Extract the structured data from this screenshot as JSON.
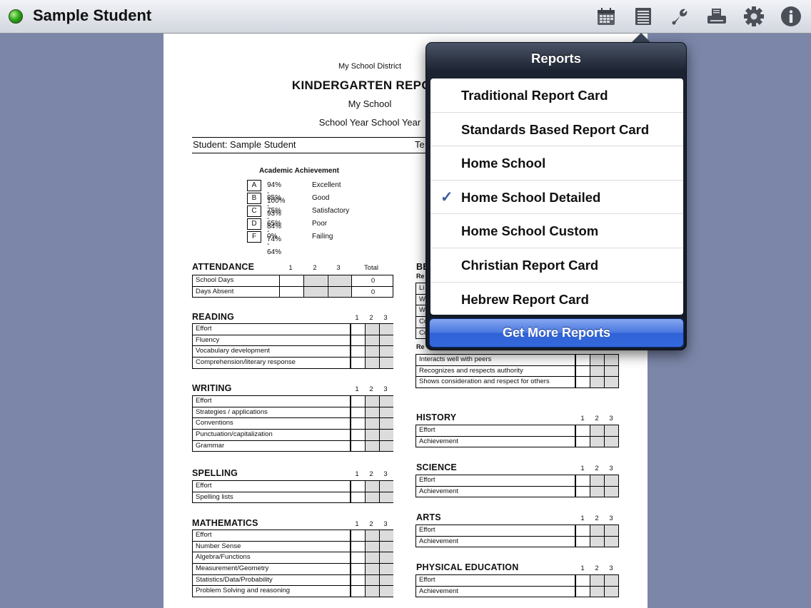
{
  "app": {
    "title": "Sample Student"
  },
  "toolbar": {
    "icons": [
      "calendar-icon",
      "list-icon",
      "wrench-icon",
      "printer-icon",
      "gear-icon",
      "info-icon"
    ]
  },
  "report": {
    "district": "My School District",
    "title": "KINDERGARTEN REPORT",
    "school": "My School",
    "year": "School Year School Year",
    "student": "Student: Sample Student",
    "teacher_fragment": "Te",
    "academic_title": "Academic Achievement",
    "grading_scale": [
      {
        "letter": "A",
        "range": "94% - 100%",
        "desc": "Excellent"
      },
      {
        "letter": "B",
        "range": "85% - 93%",
        "desc": "Good"
      },
      {
        "letter": "C",
        "range": "75% - 84%",
        "desc": "Satisfactory"
      },
      {
        "letter": "D",
        "range": "65% - 74%",
        "desc": "Poor"
      },
      {
        "letter": "F",
        "range": "0% - 64%",
        "desc": "Failing"
      }
    ],
    "attendance": {
      "title": "ATTENDANCE",
      "cols": [
        "1",
        "2",
        "3",
        "Total"
      ],
      "rows": [
        {
          "label": "School Days",
          "total": "0"
        },
        {
          "label": "Days Absent",
          "total": "0"
        }
      ]
    },
    "col_labels": [
      "1",
      "2",
      "3"
    ],
    "reading": {
      "title": "READING",
      "rows": [
        "Effort",
        "Fluency",
        "Vocabulary development",
        "Comprehension/literary response"
      ]
    },
    "writing": {
      "title": "WRITING",
      "rows": [
        "Effort",
        "Strategies / applications",
        "Conventions",
        "Punctuation/capitalization",
        "Grammar"
      ]
    },
    "spelling": {
      "title": "SPELLING",
      "rows": [
        "Effort",
        "Spelling lists"
      ]
    },
    "mathematics": {
      "title": "MATHEMATICS",
      "rows": [
        "Effort",
        "Number Sense",
        "Algebra/Functions",
        "Measurement/Geometry",
        "Statistics/Data/Probability",
        "Problem Solving and reasoning"
      ]
    },
    "behavior_fragment": {
      "title": "BE",
      "sub1": "Re",
      "rows_partial": [
        "Li",
        "W",
        "W",
        "Co",
        "Co"
      ],
      "sub2": "Re"
    },
    "social": {
      "rows": [
        "Interacts well with peers",
        "Recognizes and respects authority",
        "Shows consideration and respect for others"
      ]
    },
    "history": {
      "title": "HISTORY",
      "rows": [
        "Effort",
        "Achievement"
      ]
    },
    "science": {
      "title": "SCIENCE",
      "rows": [
        "Effort",
        "Achievement"
      ]
    },
    "arts": {
      "title": "ARTS",
      "rows": [
        "Effort",
        "Achievement"
      ]
    },
    "pe": {
      "title": "PHYSICAL EDUCATION",
      "rows": [
        "Effort",
        "Achievement"
      ]
    }
  },
  "popover": {
    "title": "Reports",
    "items": [
      {
        "label": "Traditional Report Card",
        "checked": false
      },
      {
        "label": "Standards Based Report Card",
        "checked": false
      },
      {
        "label": "Home School",
        "checked": false
      },
      {
        "label": "Home School Detailed",
        "checked": true
      },
      {
        "label": "Home School Custom",
        "checked": false
      },
      {
        "label": "Christian Report Card",
        "checked": false
      },
      {
        "label": "Hebrew Report Card",
        "checked": false
      }
    ],
    "check_glyph": "✓",
    "button_label": "Get More Reports"
  }
}
